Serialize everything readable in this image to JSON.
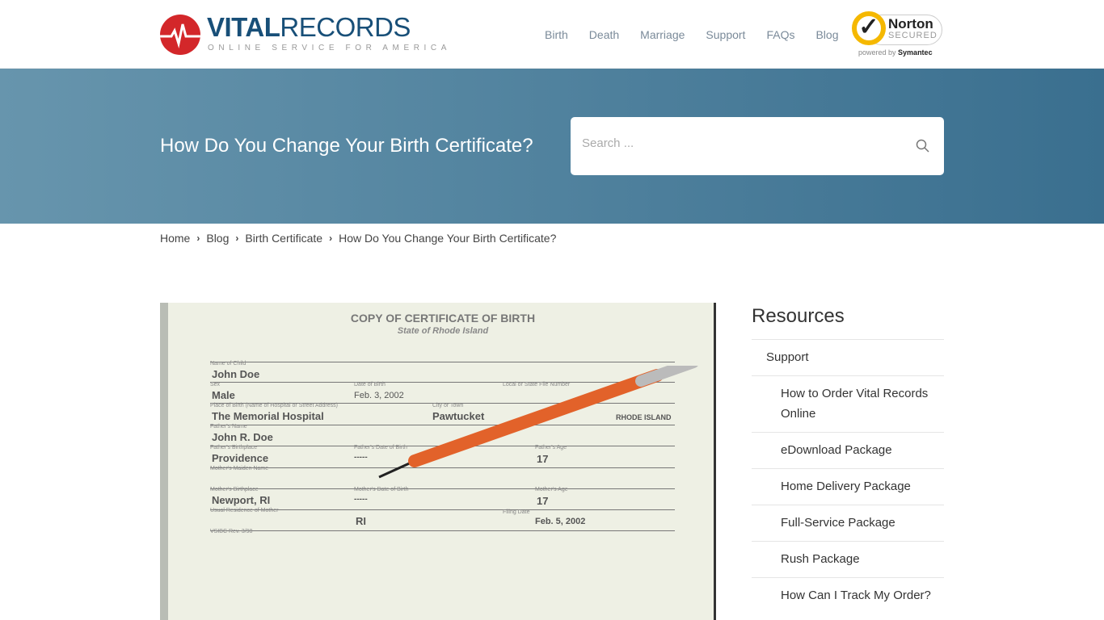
{
  "header": {
    "logo": {
      "word1": "VITAL",
      "word2": "RECORDS",
      "tagline": "ONLINE SERVICE FOR AMERICA"
    },
    "nav": [
      {
        "label": "Birth"
      },
      {
        "label": "Death"
      },
      {
        "label": "Marriage"
      },
      {
        "label": "Support"
      },
      {
        "label": "FAQs"
      },
      {
        "label": "Blog"
      }
    ],
    "badge": {
      "name": "Norton",
      "secured": "SECURED",
      "powered": "powered by",
      "brand": "Symantec"
    }
  },
  "hero": {
    "title": "How Do You Change Your Birth Certificate?",
    "search_placeholder": "Search ..."
  },
  "breadcrumb": [
    {
      "label": "Home"
    },
    {
      "label": "Blog"
    },
    {
      "label": "Birth Certificate"
    },
    {
      "label": "How Do You Change Your Birth Certificate?"
    }
  ],
  "certificate": {
    "title": "COPY OF CERTIFICATE OF BIRTH",
    "state": "State of Rhode Island",
    "labels": {
      "child": "Name of Child",
      "sex": "Sex",
      "dob": "Date of Birth",
      "file": "Local or State File Number",
      "place": "Place of Birth (Name of Hospital or Street Address)",
      "city": "City or Town",
      "father": "Father's Name",
      "fbirth": "Father's Birthplace",
      "fdob": "Father's Date of Birth",
      "fage": "Father's Age",
      "mother": "Mother's Maiden Name",
      "mbirth": "Mother's Birthplace",
      "mdob": "Mother's Date of Birth",
      "mage": "Mother's Age",
      "res": "Usual Residence of Mother",
      "filing": "Filing Date",
      "form": "VSIBC Rev. 3/98"
    },
    "values": {
      "child": "John Doe",
      "sex": "Male",
      "dob": "Feb. 3, 2002",
      "place": "The Memorial Hospital",
      "city": "Pawtucket",
      "county": "RHODE ISLAND",
      "father": "John R. Doe",
      "fbirth": "Providence",
      "fdob": "-----",
      "fage": "17",
      "mbirth": "Newport, RI",
      "mdob": "-----",
      "mage": "17",
      "res": "RI",
      "filing": "Feb. 5, 2002"
    }
  },
  "sidebar": {
    "title": "Resources",
    "items": [
      {
        "label": "Support"
      },
      {
        "label": "How to Order Vital Records Online"
      },
      {
        "label": "eDownload Package"
      },
      {
        "label": "Home Delivery Package"
      },
      {
        "label": "Full-Service Package"
      },
      {
        "label": "Rush Package"
      },
      {
        "label": "How Can I Track My Order?"
      }
    ]
  },
  "colors": {
    "brand_blue": "#184f78",
    "brand_red": "#d3272a",
    "hero_from": "#6795ad",
    "hero_to": "#3a6f8f"
  }
}
